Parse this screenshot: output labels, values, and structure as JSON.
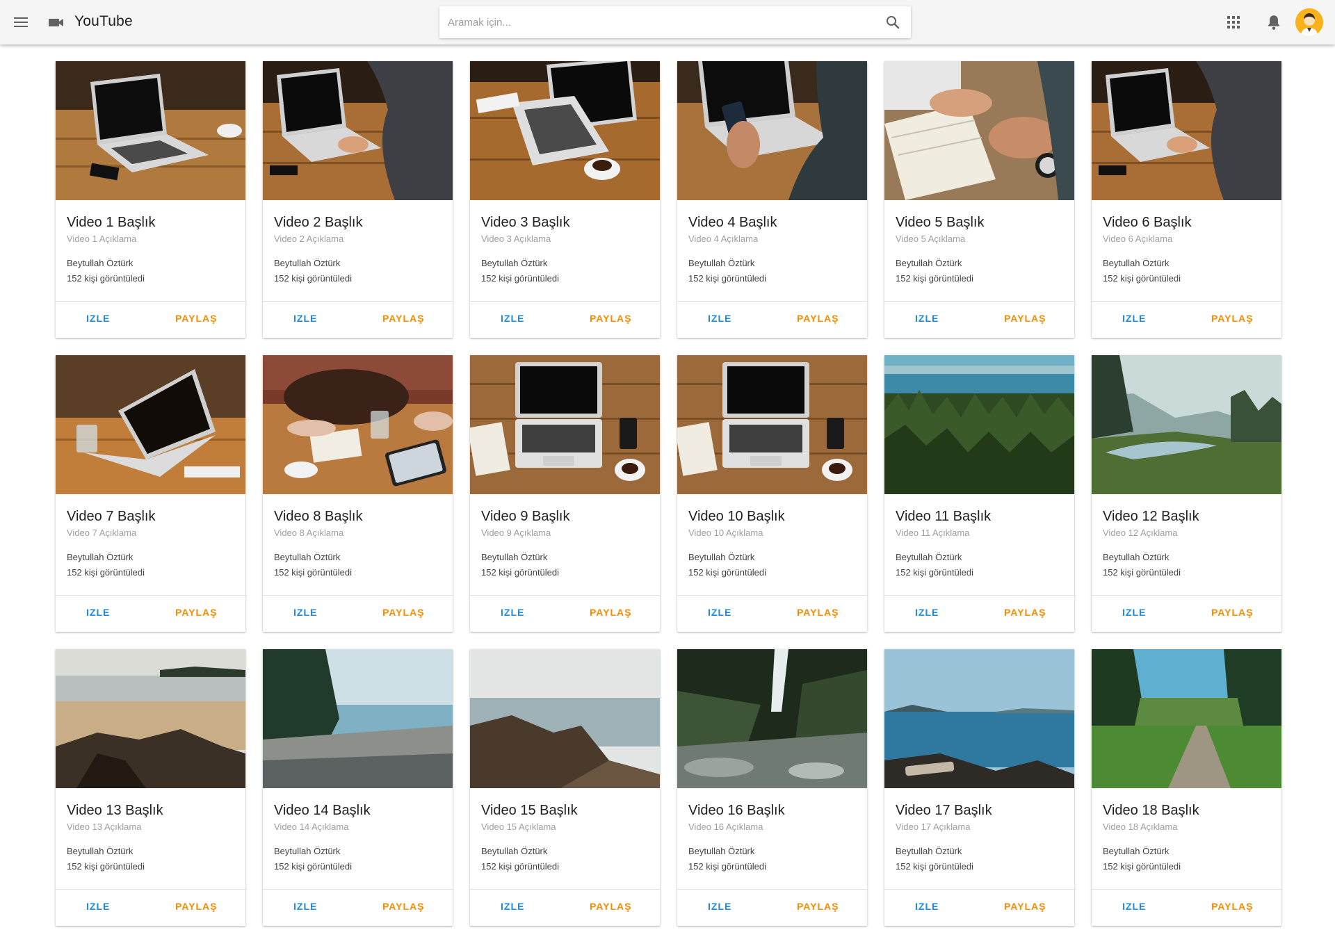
{
  "header": {
    "title": "YouTube",
    "search_placeholder": "Aramak için...",
    "icons": [
      "menu-icon",
      "videocam-icon",
      "search-icon",
      "apps-icon",
      "bell-icon",
      "avatar"
    ]
  },
  "colors": {
    "primary": "#1e88e5",
    "accent": "#fb8c00",
    "avatar_bg": "#f9b21b"
  },
  "videos": [
    {
      "title": "Video 1 Başlık",
      "description": "Video 1 Açıklama",
      "author": "Beytullah Öztürk",
      "views": "152 kişi görüntüledi",
      "watch_label": "IZLE",
      "share_label": "PAYLAŞ",
      "thumb": "laptop-desk"
    },
    {
      "title": "Video 2 Başlık",
      "description": "Video 2 Açıklama",
      "author": "Beytullah Öztürk",
      "views": "152 kişi görüntüledi",
      "watch_label": "IZLE",
      "share_label": "PAYLAŞ",
      "thumb": "laptop-typing"
    },
    {
      "title": "Video 3 Başlık",
      "description": "Video 3 Açıklama",
      "author": "Beytullah Öztürk",
      "views": "152 kişi görüntüledi",
      "watch_label": "IZLE",
      "share_label": "PAYLAŞ",
      "thumb": "laptop-coffee"
    },
    {
      "title": "Video 4 Başlık",
      "description": "Video 4 Açıklama",
      "author": "Beytullah Öztürk",
      "views": "152 kişi görüntüledi",
      "watch_label": "IZLE",
      "share_label": "PAYLAŞ",
      "thumb": "laptop-phone"
    },
    {
      "title": "Video 5 Başlık",
      "description": "Video 5 Açıklama",
      "author": "Beytullah Öztürk",
      "views": "152 kişi görüntüledi",
      "watch_label": "IZLE",
      "share_label": "PAYLAŞ",
      "thumb": "writing-notebook"
    },
    {
      "title": "Video 6 Başlık",
      "description": "Video 6 Açıklama",
      "author": "Beytullah Öztürk",
      "views": "152 kişi görüntüledi",
      "watch_label": "IZLE",
      "share_label": "PAYLAŞ",
      "thumb": "laptop-typing"
    },
    {
      "title": "Video 7 Başlık",
      "description": "Video 7 Açıklama",
      "author": "Beytullah Öztürk",
      "views": "152 kişi görüntüledi",
      "watch_label": "IZLE",
      "share_label": "PAYLAŞ",
      "thumb": "laptop-angled"
    },
    {
      "title": "Video 8 Başlık",
      "description": "Video 8 Açıklama",
      "author": "Beytullah Öztürk",
      "views": "152 kişi görüntüledi",
      "watch_label": "IZLE",
      "share_label": "PAYLAŞ",
      "thumb": "bag-tablet"
    },
    {
      "title": "Video 9 Başlık",
      "description": "Video 9 Açıklama",
      "author": "Beytullah Öztürk",
      "views": "152 kişi görüntüledi",
      "watch_label": "IZLE",
      "share_label": "PAYLAŞ",
      "thumb": "laptop-topdown"
    },
    {
      "title": "Video 10 Başlık",
      "description": "Video 10 Açıklama",
      "author": "Beytullah Öztürk",
      "views": "152 kişi görüntüledi",
      "watch_label": "IZLE",
      "share_label": "PAYLAŞ",
      "thumb": "laptop-topdown"
    },
    {
      "title": "Video 11 Başlık",
      "description": "Video 11 Açıklama",
      "author": "Beytullah Öztürk",
      "views": "152 kişi görüntüledi",
      "watch_label": "IZLE",
      "share_label": "PAYLAŞ",
      "thumb": "forest-sea"
    },
    {
      "title": "Video 12 Başlık",
      "description": "Video 12 Açıklama",
      "author": "Beytullah Öztürk",
      "views": "152 kişi görüntüledi",
      "watch_label": "IZLE",
      "share_label": "PAYLAŞ",
      "thumb": "misty-valley"
    },
    {
      "title": "Video 13 Başlık",
      "description": "Video 13 Açıklama",
      "author": "Beytullah Öztürk",
      "views": "152 kişi görüntüledi",
      "watch_label": "IZLE",
      "share_label": "PAYLAŞ",
      "thumb": "beach-rocks"
    },
    {
      "title": "Video 14 Başlık",
      "description": "Video 14 Açıklama",
      "author": "Beytullah Öztürk",
      "views": "152 kişi görüntüledi",
      "watch_label": "IZLE",
      "share_label": "PAYLAŞ",
      "thumb": "pebble-shore"
    },
    {
      "title": "Video 15 Başlık",
      "description": "Video 15 Açıklama",
      "author": "Beytullah Öztürk",
      "views": "152 kişi görüntüledi",
      "watch_label": "IZLE",
      "share_label": "PAYLAŞ",
      "thumb": "rocky-coast"
    },
    {
      "title": "Video 16 Başlık",
      "description": "Video 16 Açıklama",
      "author": "Beytullah Öztürk",
      "views": "152 kişi görüntüledi",
      "watch_label": "IZLE",
      "share_label": "PAYLAŞ",
      "thumb": "waterfall"
    },
    {
      "title": "Video 17 Başlık",
      "description": "Video 17 Açıklama",
      "author": "Beytullah Öztürk",
      "views": "152 kişi görüntüledi",
      "watch_label": "IZLE",
      "share_label": "PAYLAŞ",
      "thumb": "blue-bay"
    },
    {
      "title": "Video 18 Başlık",
      "description": "Video 18 Açıklama",
      "author": "Beytullah Öztürk",
      "views": "152 kişi görüntüledi",
      "watch_label": "IZLE",
      "share_label": "PAYLAŞ",
      "thumb": "forest-path"
    }
  ]
}
